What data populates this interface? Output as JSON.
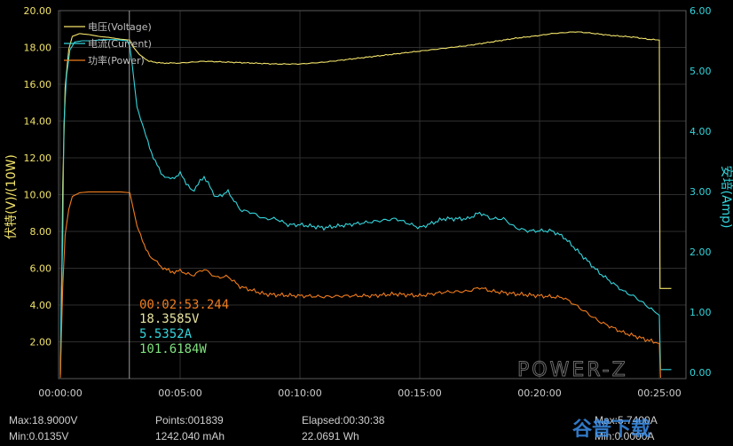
{
  "chart_data": {
    "type": "line",
    "x_ticks": [
      "00:00:00",
      "00:05:00",
      "00:10:00",
      "00:15:00",
      "00:20:00",
      "00:25:00"
    ],
    "left_axis": {
      "label": "伏特(V)/(10W)",
      "ylim": [
        0,
        20
      ],
      "ticks": [
        "2.00",
        "4.00",
        "6.00",
        "8.00",
        "10.00",
        "12.00",
        "14.00",
        "16.00",
        "18.00",
        "20.00"
      ]
    },
    "right_axis": {
      "label": "安培(Amp)",
      "ylim": [
        -0.1,
        6
      ],
      "ticks": [
        "0.00",
        "1.00",
        "2.00",
        "3.00",
        "4.00",
        "5.00",
        "6.00"
      ]
    },
    "legend": [
      {
        "label": "电压(Voltage)",
        "color": "#f2e36a"
      },
      {
        "label": "电流(Current)",
        "color": "#33d6dd"
      },
      {
        "label": "功率(Power)",
        "color": "#f07c1c"
      }
    ],
    "series": [
      {
        "name": "电压(Voltage)",
        "axis": "left",
        "color": "#f2e36a",
        "x_min": [
          0,
          0.05,
          0.1,
          0.2,
          0.35,
          0.5,
          0.8,
          1.2,
          1.6,
          2.0,
          2.5,
          2.9,
          3.0,
          3.3,
          3.7,
          4.2,
          5,
          6,
          7,
          8,
          9,
          10,
          11,
          12,
          13,
          14,
          15,
          16,
          17,
          18,
          19,
          20,
          20.5,
          21,
          21.5,
          22,
          23,
          24,
          24.5,
          25.0,
          25.03,
          25.2,
          25.5
        ],
        "values": [
          0.2,
          3.5,
          10.5,
          15.8,
          17.9,
          18.6,
          18.75,
          18.7,
          18.6,
          18.55,
          18.45,
          18.4,
          18.1,
          17.6,
          17.25,
          17.15,
          17.15,
          17.25,
          17.2,
          17.15,
          17.1,
          17.1,
          17.2,
          17.35,
          17.5,
          17.65,
          17.8,
          17.95,
          18.1,
          18.3,
          18.5,
          18.65,
          18.75,
          18.8,
          18.85,
          18.8,
          18.65,
          18.55,
          18.45,
          18.4,
          4.9,
          4.9,
          4.9
        ]
      },
      {
        "name": "电流(Current)",
        "axis": "right",
        "color": "#33d6dd",
        "x_min": [
          0,
          0.05,
          0.1,
          0.15,
          0.25,
          0.4,
          0.6,
          0.9,
          1.3,
          1.8,
          2.3,
          2.8,
          2.9,
          3.0,
          3.2,
          3.5,
          3.8,
          4.2,
          4.6,
          5.0,
          5.5,
          6.0,
          6.5,
          7.0,
          7.5,
          8.0,
          8.5,
          9.0,
          9.5,
          10,
          11,
          12,
          13,
          14,
          15,
          16,
          17,
          17.5,
          18,
          18.5,
          19,
          19.5,
          20,
          20.5,
          21,
          21.5,
          22,
          22.5,
          23,
          23.5,
          24,
          24.5,
          25.0,
          25.05,
          25.2,
          25.5
        ],
        "values": [
          0.05,
          1.4,
          2.2,
          4.1,
          4.9,
          5.35,
          5.48,
          5.5,
          5.5,
          5.52,
          5.52,
          5.5,
          5.4,
          5.1,
          4.4,
          4.0,
          3.65,
          3.3,
          3.2,
          3.3,
          3.0,
          3.25,
          2.9,
          3.0,
          2.7,
          2.65,
          2.55,
          2.55,
          2.45,
          2.45,
          2.4,
          2.45,
          2.5,
          2.55,
          2.4,
          2.55,
          2.55,
          2.65,
          2.55,
          2.55,
          2.4,
          2.35,
          2.35,
          2.35,
          2.25,
          2.05,
          1.85,
          1.65,
          1.5,
          1.35,
          1.25,
          1.1,
          0.95,
          0.05,
          0.05,
          0.05
        ]
      },
      {
        "name": "功率(Power)",
        "axis": "left",
        "color": "#f07c1c",
        "x_min": [
          0,
          0.05,
          0.1,
          0.2,
          0.35,
          0.5,
          0.8,
          1.2,
          1.6,
          2.0,
          2.5,
          2.9,
          3.0,
          3.2,
          3.5,
          3.8,
          4.2,
          4.6,
          5.0,
          5.5,
          6.0,
          6.5,
          7.0,
          7.5,
          8.0,
          8.5,
          9,
          10,
          11,
          12,
          13,
          14,
          15,
          16,
          17,
          17.5,
          18,
          19,
          20,
          20.5,
          21,
          21.5,
          22,
          22.5,
          23,
          23.5,
          24,
          24.5,
          25.0,
          25.05
        ],
        "values": [
          0.05,
          2.5,
          5.0,
          7.8,
          9.2,
          9.9,
          10.1,
          10.15,
          10.15,
          10.15,
          10.15,
          10.1,
          9.5,
          8.3,
          7.2,
          6.6,
          6.1,
          5.8,
          5.85,
          5.6,
          5.95,
          5.5,
          5.55,
          5.0,
          4.8,
          4.6,
          4.55,
          4.5,
          4.45,
          4.5,
          4.5,
          4.6,
          4.5,
          4.7,
          4.75,
          4.95,
          4.75,
          4.6,
          4.5,
          4.45,
          4.4,
          4.0,
          3.55,
          3.1,
          2.8,
          2.5,
          2.3,
          2.1,
          1.9,
          0.05
        ]
      }
    ],
    "cursor_x_min": 2.88
  },
  "readout": {
    "time": "00:02:53.244",
    "voltage": "18.3585V",
    "current": "5.5352A",
    "power": "101.6184W"
  },
  "footer": {
    "max": "Max:18.9000V",
    "min": "Min:0.0135V",
    "points": "Points:001839",
    "capacity": "1242.040 mAh",
    "elapsed": "Elapsed:00:30:38",
    "energy": "22.0691 Wh",
    "max_right": "Max:5.7400A",
    "min_right": "Min:0.0000A"
  },
  "watermark": "POWER-Z",
  "brand_mark": "谷普下载"
}
